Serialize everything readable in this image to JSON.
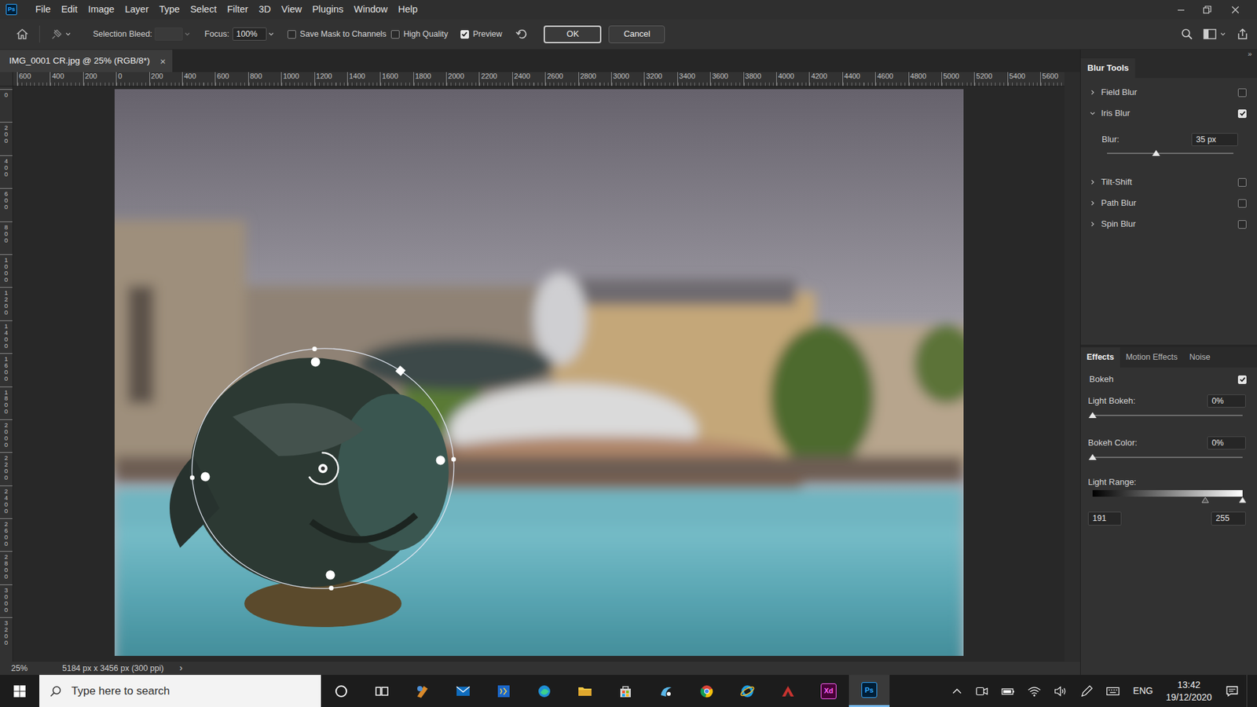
{
  "app": {
    "logo": "Ps"
  },
  "menu": [
    "File",
    "Edit",
    "Image",
    "Layer",
    "Type",
    "Select",
    "Filter",
    "3D",
    "View",
    "Plugins",
    "Window",
    "Help"
  ],
  "options_bar": {
    "selection_bleed": {
      "label": "Selection Bleed:",
      "disabled": true
    },
    "focus": {
      "label": "Focus:",
      "value": "100%"
    },
    "checkboxes": [
      {
        "label": "Save Mask to Channels",
        "checked": false
      },
      {
        "label": "High Quality",
        "checked": false
      },
      {
        "label": "Preview",
        "checked": true
      }
    ],
    "buttons": [
      {
        "label": "OK",
        "default": true
      },
      {
        "label": "Cancel",
        "default": false
      }
    ]
  },
  "document": {
    "tab": {
      "title": "IMG_0001 CR.jpg @ 25% (RGB/8*)",
      "close": "×",
      "selected": true
    }
  },
  "rulers": {
    "top": [
      "600",
      "400",
      "200",
      "0",
      "200",
      "400",
      "600",
      "800",
      "1000",
      "1200",
      "1400",
      "1600",
      "1800",
      "2000",
      "2200",
      "2400",
      "2600",
      "2800",
      "3000",
      "3200",
      "3400",
      "3600",
      "3800",
      "4000",
      "4200",
      "4400",
      "4600",
      "4800",
      "5000",
      "5200",
      "5400",
      "5600"
    ],
    "left": [
      "0",
      "200",
      "400",
      "600",
      "800",
      "1000",
      "1200",
      "1400",
      "1600",
      "1800",
      "2000",
      "2200",
      "2400",
      "2600",
      "2800",
      "3000",
      "3200"
    ]
  },
  "status_bar": {
    "zoom": "25%",
    "info": "5184 px x 3456 px (300 ppi)",
    "more": "›"
  },
  "blur_tools": {
    "title": "Blur Tools",
    "collapse": "»",
    "items": [
      {
        "label": "Field Blur",
        "checked": false,
        "expanded": false
      },
      {
        "label": "Iris Blur",
        "checked": true,
        "expanded": true,
        "setting": {
          "label": "Blur:",
          "value": "35 px",
          "level": 0.39
        }
      },
      {
        "label": "Tilt-Shift",
        "checked": false,
        "expanded": false
      },
      {
        "label": "Path Blur",
        "checked": false,
        "expanded": false
      },
      {
        "label": "Spin Blur",
        "checked": false,
        "expanded": false
      }
    ]
  },
  "effects": {
    "tabs": [
      {
        "label": "Effects",
        "selected": true
      },
      {
        "label": "Motion Effects",
        "selected": false
      },
      {
        "label": "Noise",
        "selected": false
      }
    ],
    "bokeh": {
      "label": "Bokeh",
      "checked": true
    },
    "sliders": [
      {
        "label": "Light Bokeh:",
        "value": "0%",
        "level": 0
      },
      {
        "label": "Bokeh Color:",
        "value": "0%",
        "level": 0
      }
    ],
    "light_range": {
      "label": "Light Range:",
      "low": "191",
      "high": "255",
      "low_level": 0.749,
      "high_level": 1
    }
  },
  "taskbar": {
    "search_placeholder": "Type here to search",
    "apps": [
      {
        "label": "Xd",
        "selected": false
      },
      {
        "label": "Ps",
        "selected": true
      }
    ],
    "tray": {
      "language": "ENG",
      "time": "13:42",
      "date": "19/12/2020"
    }
  }
}
